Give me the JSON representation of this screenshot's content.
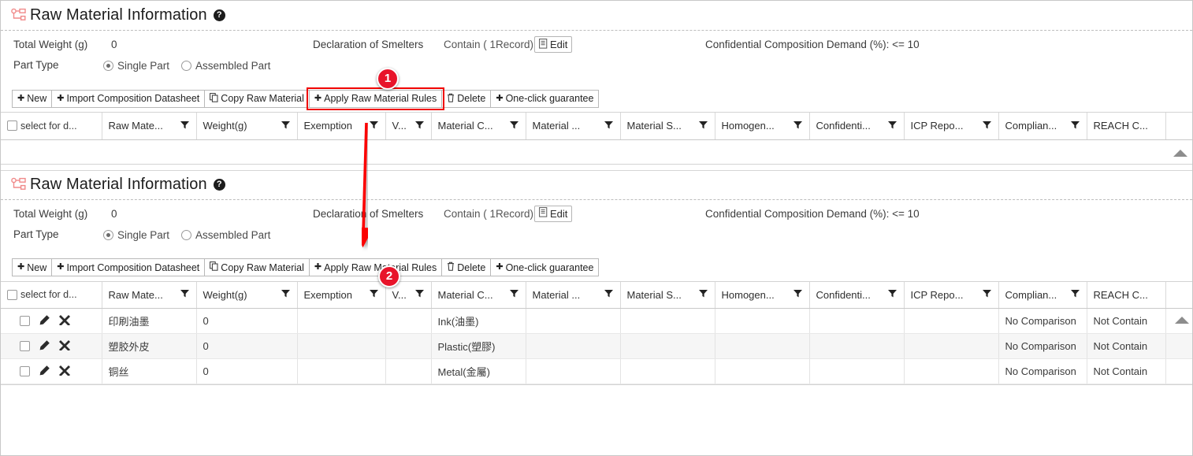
{
  "sections": [
    {
      "title": "Raw Material Information",
      "help": "?",
      "fields": {
        "total_weight_label": "Total Weight (g)",
        "total_weight_value": "0",
        "declaration_label": "Declaration of Smelters",
        "declaration_value": "Contain ( 1Record)",
        "edit_label": "Edit",
        "confidential_label": "Confidential Composition Demand (%): <= 10",
        "part_type_label": "Part Type",
        "radio_single": "Single Part",
        "radio_assembled": "Assembled Part",
        "radio_selected": "Single Part"
      },
      "toolbar": [
        {
          "label": "New",
          "icon": "plus-icon"
        },
        {
          "label": "Import Composition Datasheet",
          "icon": "plus-icon"
        },
        {
          "label": "Copy Raw Material",
          "icon": "copy-icon"
        },
        {
          "label": "Apply Raw Material Rules",
          "icon": "plus-icon",
          "highlighted": true
        },
        {
          "label": "Delete",
          "icon": "trash-icon"
        },
        {
          "label": "One-click guarantee",
          "icon": "plus-icon"
        }
      ],
      "columns": [
        {
          "label": "select for d...",
          "filter": false,
          "checkbox": true
        },
        {
          "label": "Raw Mate...",
          "filter": true
        },
        {
          "label": "Weight(g)",
          "filter": true
        },
        {
          "label": "Exemption",
          "filter": true
        },
        {
          "label": "V...",
          "filter": true
        },
        {
          "label": "Material C...",
          "filter": true
        },
        {
          "label": "Material ...",
          "filter": true
        },
        {
          "label": "Material S...",
          "filter": true
        },
        {
          "label": "Homogen...",
          "filter": true
        },
        {
          "label": "Confidenti...",
          "filter": true
        },
        {
          "label": "ICP Repo...",
          "filter": true
        },
        {
          "label": "Complian...",
          "filter": true
        },
        {
          "label": "REACH C...",
          "filter": false
        }
      ],
      "rows": []
    },
    {
      "title": "Raw Material Information",
      "help": "?",
      "fields": {
        "total_weight_label": "Total Weight (g)",
        "total_weight_value": "0",
        "declaration_label": "Declaration of Smelters",
        "declaration_value": "Contain ( 1Record)",
        "edit_label": "Edit",
        "confidential_label": "Confidential Composition Demand (%): <= 10",
        "part_type_label": "Part Type",
        "radio_single": "Single Part",
        "radio_assembled": "Assembled Part",
        "radio_selected": "Single Part"
      },
      "toolbar": [
        {
          "label": "New",
          "icon": "plus-icon"
        },
        {
          "label": "Import Composition Datasheet",
          "icon": "plus-icon"
        },
        {
          "label": "Copy Raw Material",
          "icon": "copy-icon"
        },
        {
          "label": "Apply Raw Material Rules",
          "icon": "plus-icon",
          "highlighted": false
        },
        {
          "label": "Delete",
          "icon": "trash-icon"
        },
        {
          "label": "One-click guarantee",
          "icon": "plus-icon"
        }
      ],
      "columns": [
        {
          "label": "select for d...",
          "filter": false,
          "checkbox": true
        },
        {
          "label": "Raw Mate...",
          "filter": true
        },
        {
          "label": "Weight(g)",
          "filter": true
        },
        {
          "label": "Exemption",
          "filter": true
        },
        {
          "label": "V...",
          "filter": true
        },
        {
          "label": "Material C...",
          "filter": true
        },
        {
          "label": "Material ...",
          "filter": true
        },
        {
          "label": "Material S...",
          "filter": true
        },
        {
          "label": "Homogen...",
          "filter": true
        },
        {
          "label": "Confidenti...",
          "filter": true
        },
        {
          "label": "ICP Repo...",
          "filter": true
        },
        {
          "label": "Complian...",
          "filter": true
        },
        {
          "label": "REACH C...",
          "filter": false
        }
      ],
      "rows": [
        {
          "raw_material": "印刷油墨",
          "weight": "0",
          "exemption": "",
          "v": "",
          "material_c": "Ink(油墨)",
          "material_2": "",
          "material_s": "",
          "homogen": "",
          "confidential": "",
          "icp_report": "",
          "compliance": "No Comparison",
          "reach": "Not Contain"
        },
        {
          "raw_material": "塑胶外皮",
          "weight": "0",
          "exemption": "",
          "v": "",
          "material_c": "Plastic(塑膠)",
          "material_2": "",
          "material_s": "",
          "homogen": "",
          "confidential": "",
          "icp_report": "",
          "compliance": "No Comparison",
          "reach": "Not Contain"
        },
        {
          "raw_material": "铜丝",
          "weight": "0",
          "exemption": "",
          "v": "",
          "material_c": "Metal(金屬)",
          "material_2": "",
          "material_s": "",
          "homogen": "",
          "confidential": "",
          "icp_report": "",
          "compliance": "No Comparison",
          "reach": "Not Contain"
        }
      ]
    }
  ],
  "annotations": {
    "badge_1": "1",
    "badge_2": "2"
  },
  "colors": {
    "annotation_red": "#e8142a",
    "highlight_red": "#f00402",
    "tree_icon": "#f08a8a"
  }
}
